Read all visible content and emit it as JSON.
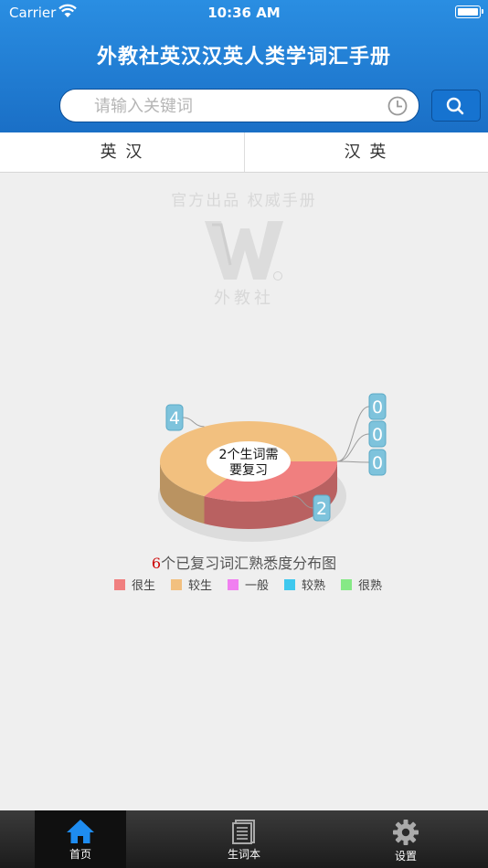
{
  "status_bar": {
    "carrier": "Carrier",
    "time": "10:36 AM"
  },
  "header": {
    "title": "外教社英汉汉英人类学词汇手册"
  },
  "search": {
    "placeholder": "请输入关键词"
  },
  "tabs": [
    {
      "label": "英 汉"
    },
    {
      "label": "汉 英"
    }
  ],
  "watermark": {
    "tagline": "官方出品 权威手册",
    "brand": "外教社"
  },
  "chart_data": {
    "type": "pie",
    "center_label": [
      "2个生词需",
      "要复习"
    ],
    "series": [
      {
        "name": "很生",
        "value": 2,
        "color": "#f07f7f"
      },
      {
        "name": "较生",
        "value": 4,
        "color": "#f2c07f"
      },
      {
        "name": "一般",
        "value": 0,
        "color": "#f07ff0"
      },
      {
        "name": "较熟",
        "value": 0,
        "color": "#3ec8ee"
      },
      {
        "name": "很熟",
        "value": 0,
        "color": "#86e986"
      }
    ],
    "caption_number": "6",
    "caption_text": "个已复习词汇熟悉度分布图"
  },
  "tabbar": [
    {
      "label": "首页",
      "icon": "home-icon",
      "active": true
    },
    {
      "label": "生词本",
      "icon": "notebook-icon",
      "active": false
    },
    {
      "label": "设置",
      "icon": "gear-icon",
      "active": false
    }
  ]
}
